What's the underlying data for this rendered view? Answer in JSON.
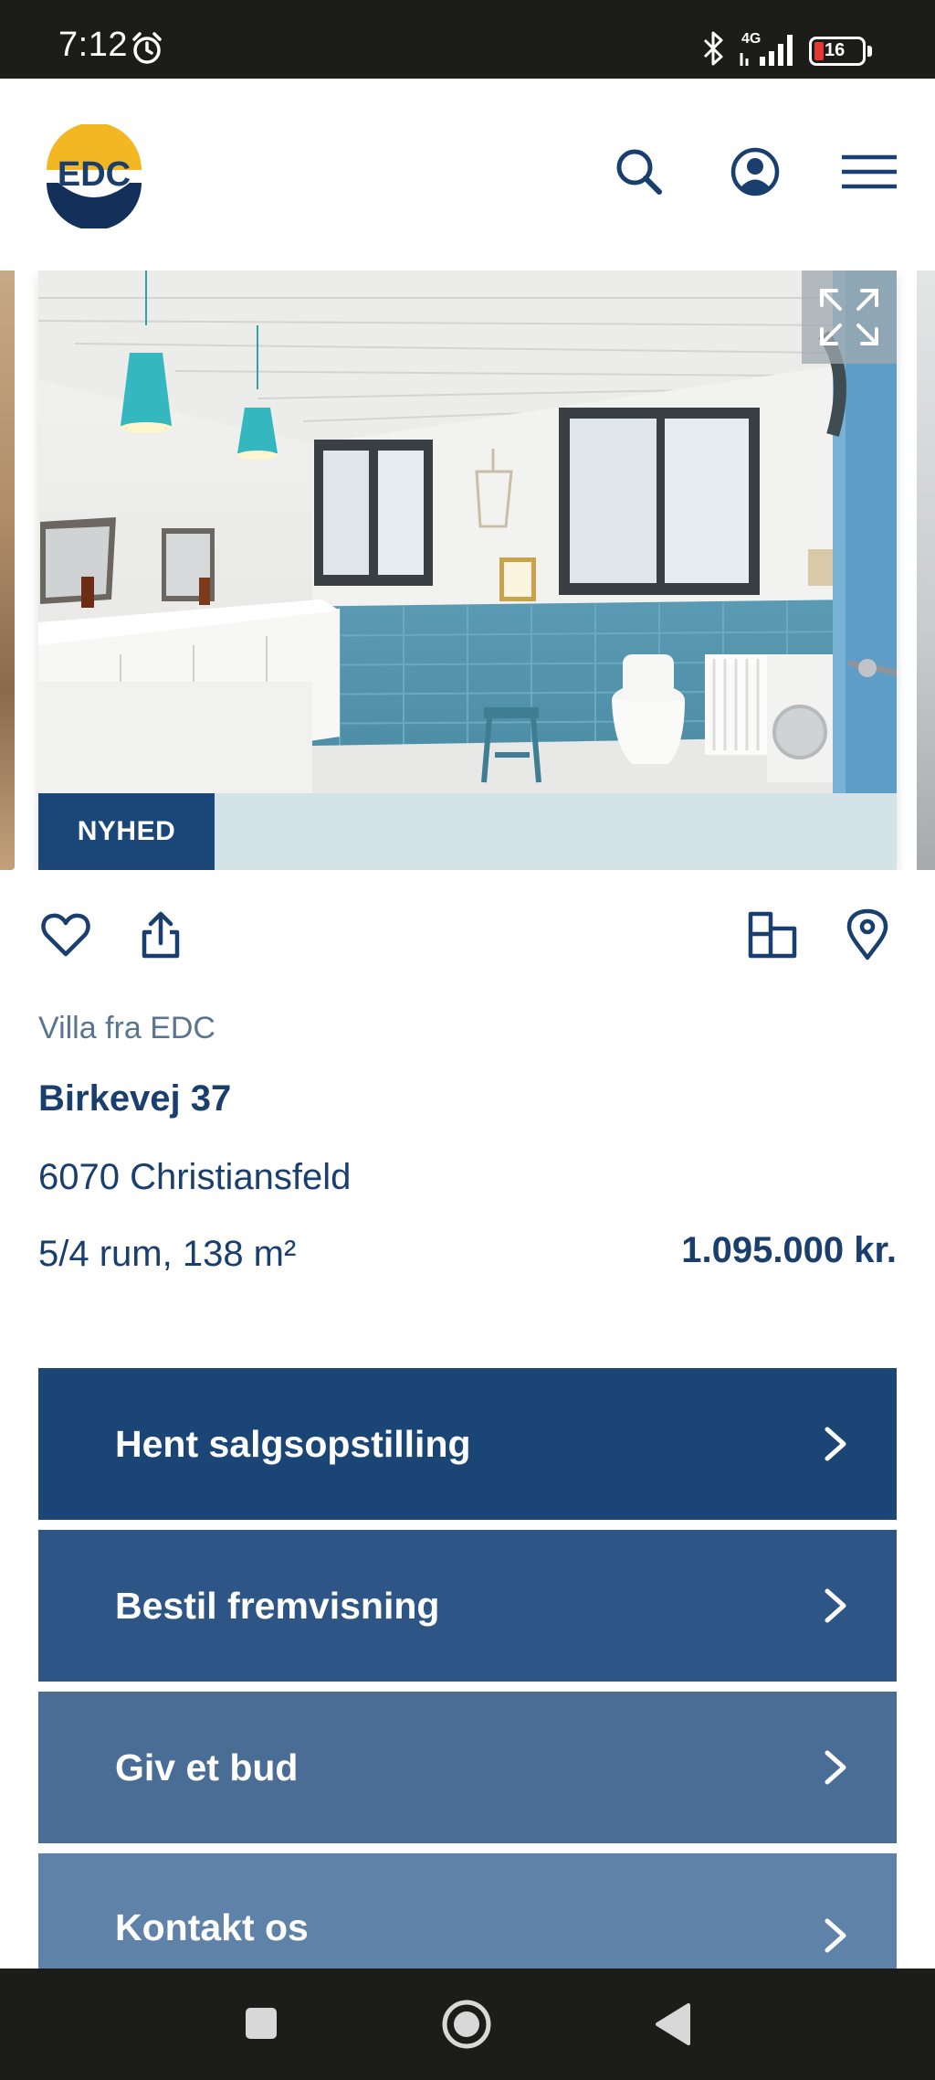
{
  "status_bar": {
    "time": "7:12",
    "network": "4G",
    "battery": "16"
  },
  "header": {
    "logo_text": "EDC"
  },
  "gallery": {
    "badge": "NYHED"
  },
  "listing": {
    "type": "Villa fra EDC",
    "address": "Birkevej 37",
    "city": "6070 Christiansfeld",
    "rooms": "5/4 rum, 138 m²",
    "price": "1.095.000 kr."
  },
  "actions": [
    {
      "label": "Hent salgsopstilling"
    },
    {
      "label": "Bestil fremvisning"
    },
    {
      "label": "Giv et bud"
    },
    {
      "label": "Kontakt os"
    }
  ],
  "colors": {
    "brand_navy": "#1a4575",
    "brand_yellow": "#f2b722",
    "text_navy": "#1a3f6e",
    "muted_text": "#5a7591",
    "badge_bg": "#1a4777"
  }
}
